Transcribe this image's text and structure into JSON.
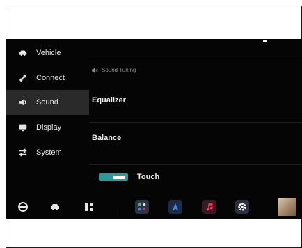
{
  "sidebar": {
    "items": [
      {
        "label": "Vehicle",
        "icon": "car-icon",
        "active": false
      },
      {
        "label": "Connect",
        "icon": "link-icon",
        "active": false
      },
      {
        "label": "Sound",
        "icon": "speaker-icon",
        "active": true
      },
      {
        "label": "Display",
        "icon": "monitor-icon",
        "active": false
      },
      {
        "label": "System",
        "icon": "sliders-icon",
        "active": false
      }
    ]
  },
  "content": {
    "section_title": "Sound Tuning",
    "settings": [
      {
        "label": "Equalizer"
      },
      {
        "label": "Balance"
      }
    ],
    "touch": {
      "label": "Touch",
      "enabled": true
    }
  },
  "dock": {
    "left_icons": [
      "steering-wheel-icon",
      "car-icon",
      "apps-grid-icon"
    ],
    "apps": [
      {
        "icon": "phone-app-icon",
        "color": "#2b3344"
      },
      {
        "icon": "navigation-app-icon",
        "color": "#1f2a46"
      },
      {
        "icon": "music-app-icon",
        "color": "#3a1a20"
      },
      {
        "icon": "settings-app-icon",
        "color": "#2a3040"
      }
    ],
    "avatar": "user-avatar"
  },
  "colors": {
    "accent_toggle": "#2a9a9a",
    "screen_background": "#050505",
    "active_item": "#2a2a2a"
  }
}
